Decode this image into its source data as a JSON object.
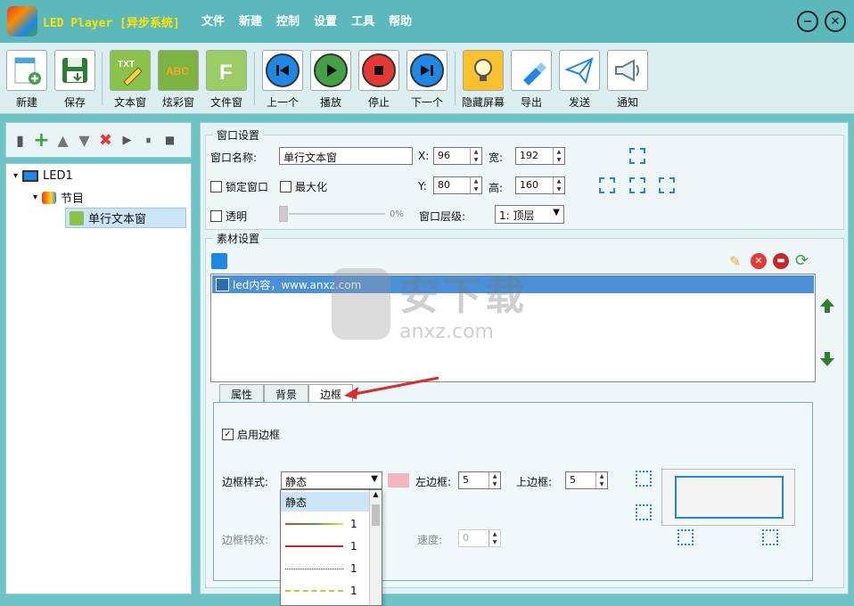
{
  "app": {
    "title": "LED Player [异步系统]"
  },
  "menu": [
    "文件",
    "新建",
    "控制",
    "设置",
    "工具",
    "帮助"
  ],
  "window_controls": {
    "minimize": "−",
    "close": "✕"
  },
  "toolbar": [
    "新建",
    "保存",
    "文本窗",
    "炫彩窗",
    "文件窗",
    "上一个",
    "播放",
    "停止",
    "下一个",
    "隐藏屏幕",
    "导出",
    "发送",
    "通知"
  ],
  "toolbar_icon_text": {
    "text": "TXT",
    "color": "ABC",
    "file": "F"
  },
  "tree": {
    "root": "LED1",
    "program": "节目",
    "item": "单行文本窗"
  },
  "window_settings": {
    "group_title": "窗口设置",
    "name_label": "窗口名称:",
    "name_value": "单行文本窗",
    "x_label": "X:",
    "x_value": "96",
    "width_label": "宽:",
    "width_value": "192",
    "lock_label": "锁定窗口",
    "maximize_label": "最大化",
    "y_label": "Y:",
    "y_value": "80",
    "height_label": "高:",
    "height_value": "160",
    "transparent_label": "透明",
    "transparency_value": "0%",
    "layer_label": "窗口层级:",
    "layer_value": "1: 顶层"
  },
  "material": {
    "group_title": "素材设置",
    "item": "led内容，www.anxz.com"
  },
  "tabs": [
    "属性",
    "背景",
    "边框"
  ],
  "border": {
    "enable_label": "启用边框",
    "style_label": "边框样式:",
    "style_value": "静态",
    "left_label": "左边框:",
    "left_value": "5",
    "top_label": "上边框:",
    "top_value": "5",
    "effect_label": "边框特效:",
    "speed_label": "速度:",
    "speed_value": "0",
    "options": [
      "静态",
      "1",
      "1",
      "1",
      "1"
    ],
    "swatch_color": "#f4b6bd"
  },
  "watermark": {
    "text": "安下载",
    "sub": "anxz.com"
  }
}
